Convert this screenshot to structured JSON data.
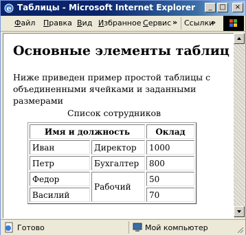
{
  "window": {
    "title": "Таблицы - Microsoft Internet Explorer"
  },
  "window_controls": {
    "minimize": "_",
    "maximize": "□",
    "close": "×"
  },
  "menu": {
    "items": [
      {
        "label": "Файл",
        "key": "Ф",
        "rest": "айл"
      },
      {
        "label": "Правка",
        "key": "П",
        "rest": "равка"
      },
      {
        "label": "Вид",
        "key": "В",
        "rest": "ид"
      },
      {
        "label": "Избранное",
        "key": "И",
        "rest": "збранное"
      },
      {
        "label": "Сервис",
        "key": "С",
        "rest": "ервис"
      }
    ],
    "overflow": "»",
    "links_label": "Ссылки",
    "links_overflow": "»"
  },
  "page": {
    "heading": "Основные элементы таблиц",
    "intro": "Ниже приведен пример простой таблицы с объединенными ячейками и заданными размерами",
    "table": {
      "caption": "Список сотрудников",
      "headers": [
        "Имя и должность",
        "Оклад"
      ],
      "rows": [
        {
          "name": "Иван",
          "position": "Директор",
          "salary": "1000"
        },
        {
          "name": "Петр",
          "position": "Бухгалтер",
          "salary": "800"
        },
        {
          "name": "Федор",
          "position": "Рабочий",
          "salary": "50"
        },
        {
          "name": "Василий",
          "salary": "70"
        }
      ]
    }
  },
  "status": {
    "left": "Готово",
    "zone": "Мой компьютер"
  },
  "icons": {
    "app": "ie-icon",
    "page": "page-icon",
    "computer": "computer-icon",
    "throbber": "windows-logo-icon"
  },
  "colors": {
    "titlebar": "#0a246a",
    "chrome": "#ece9d8",
    "content": "#ffffff"
  }
}
